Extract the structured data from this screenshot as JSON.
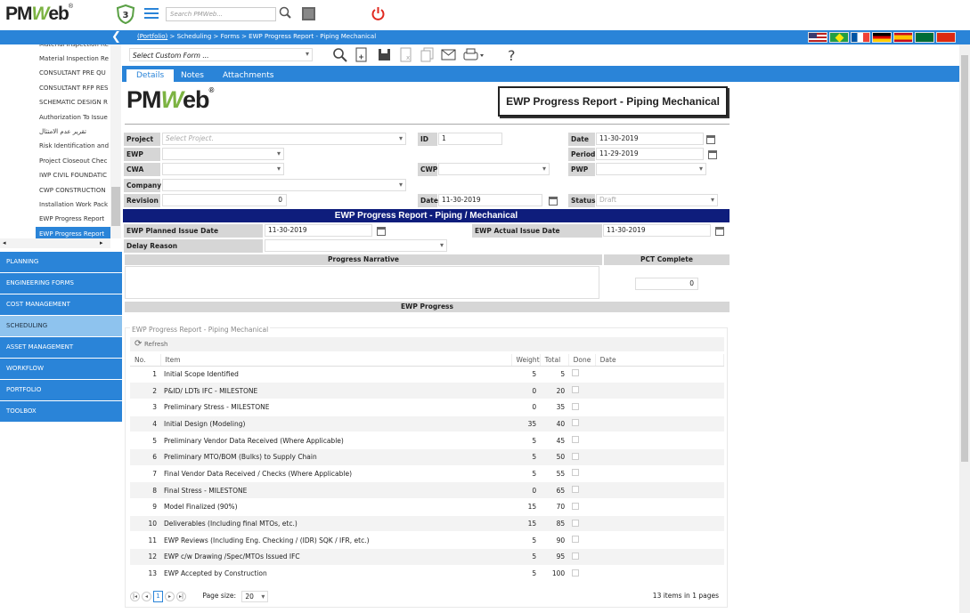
{
  "app": {
    "logo_pm": "PM",
    "logo_w": "W",
    "logo_eb": "eb",
    "logo_r": "®",
    "badge": "3",
    "search_placeholder": "Search PMWeb...",
    "power": "⏻"
  },
  "breadcrumb": {
    "portfolio": "(Portfolio)",
    "rest": " > Scheduling > Forms > EWP Progress Report - Piping Mechanical"
  },
  "sidebar": {
    "tree": [
      "Material Inspection Re",
      "CONSULTANT PRE QU",
      "CONSULTANT RFP RES",
      "SCHEMATIC DESIGN R",
      "Authorization To Issue",
      "تقرير عدم الامتثال",
      "Risk Identification and",
      "Project Closeout Chec",
      "IWP CIVIL FOUNDATIC",
      "CWP CONSTRUCTION",
      "Installation Work Pack",
      "EWP Progress Report",
      "EWP Progress Report"
    ],
    "menu": [
      "PLANNING",
      "ENGINEERING FORMS",
      "COST MANAGEMENT",
      "SCHEDULING",
      "ASSET MANAGEMENT",
      "WORKFLOW",
      "PORTFOLIO",
      "TOOLBOX"
    ]
  },
  "toolbar": {
    "custom_form_placeholder": "Select Custom Form ..."
  },
  "tabs": [
    "Details",
    "Notes",
    "Attachments"
  ],
  "form": {
    "title": "EWP Progress Report - Piping Mechanical",
    "project_label": "Project",
    "project_ph": "Select Project.",
    "id_label": "ID",
    "id_value": "1",
    "date_label": "Date",
    "date_value": "11-30-2019",
    "ewp_label": "EWP",
    "period_label": "Period",
    "period_value": "11-29-2019",
    "cwa_label": "CWA",
    "cwp_label": "CWP",
    "pwp_label": "PWP",
    "company_label": "Company",
    "revision_label": "Revision",
    "revision_value": "0",
    "date2_label": "Date",
    "date2_value": "11-30-2019",
    "status_label": "Status",
    "status_value": "Draft",
    "section_title": "EWP Progress Report - Piping / Mechanical",
    "planned_label": "EWP Planned Issue Date",
    "planned_value": "11-30-2019",
    "actual_label": "EWP Actual Issue Date",
    "actual_value": "11-30-2019",
    "delay_label": "Delay Reason",
    "narrative_label": "Progress Narrative",
    "pct_label": "PCT Complete",
    "pct_value": "0",
    "progress_label": "EWP Progress"
  },
  "grid": {
    "title": "EWP Progress Report - Piping Mechanical",
    "refresh": "Refresh",
    "headers": [
      "No.",
      "Item",
      "Weight",
      "Total",
      "Done",
      "Date"
    ],
    "rows": [
      [
        "1",
        "Initial Scope Identified",
        "5",
        "5"
      ],
      [
        "2",
        "P&ID/ LDTs IFC - MILESTONE",
        "0",
        "20"
      ],
      [
        "3",
        "Preliminary Stress - MILESTONE",
        "0",
        "35"
      ],
      [
        "4",
        "Initial Design (Modeling)",
        "35",
        "40"
      ],
      [
        "5",
        "Preliminary Vendor Data Received (Where Applicable)",
        "5",
        "45"
      ],
      [
        "6",
        "Preliminary MTO/BOM (Bulks) to Supply Chain",
        "5",
        "50"
      ],
      [
        "7",
        "Final Vendor Data Received / Checks (Where Applicable)",
        "5",
        "55"
      ],
      [
        "8",
        "Final Stress - MILESTONE",
        "0",
        "65"
      ],
      [
        "9",
        "Model Finalized (90%)",
        "15",
        "70"
      ],
      [
        "10",
        "Deliverables (Including final MTOs, etc.)",
        "15",
        "85"
      ],
      [
        "11",
        "EWP Reviews (Including Eng. Checking / (IDR) SQK / IFR, etc.)",
        "5",
        "90"
      ],
      [
        "12",
        "EWP c/w Drawing /Spec/MTOs Issued IFC",
        "5",
        "95"
      ],
      [
        "13",
        "EWP Accepted by Construction",
        "5",
        "100"
      ]
    ],
    "page": "1",
    "page_size_label": "Page size:",
    "page_size": "20",
    "items_count": "13",
    "items_mid": " items in ",
    "pages_count": "1",
    "pages_word": " pages"
  }
}
